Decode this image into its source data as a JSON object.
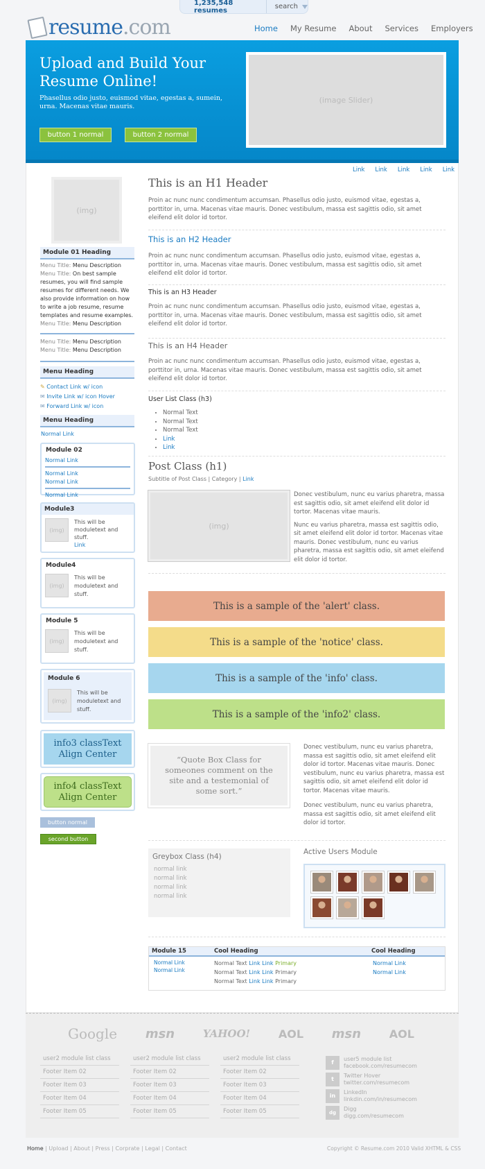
{
  "topbar": {
    "count": "1,235,548 resumes",
    "search": "search"
  },
  "logo": {
    "part1": "resume",
    "part2": ".com"
  },
  "nav": [
    "Home",
    "My Resume",
    "About",
    "Services",
    "Employers"
  ],
  "hero": {
    "title": "Upload and Build Your Resume Online!",
    "text": "Phasellus odio justo, euismod vitae, egestas a, sumein, urna. Macenas vitae mauris.",
    "button1": "button 1 normal",
    "button2": "button 2 normal",
    "slider": "(image Slider)"
  },
  "links": [
    "Link",
    "Link",
    "Link",
    "Link",
    "Link"
  ],
  "sidebar": {
    "img": "(img)",
    "mod01": "Module 01 Heading",
    "menu": [
      {
        "t": "Menu Title:",
        "d": "Menu Description"
      },
      {
        "t": "Menu Title:",
        "d": "On best sample resumes, you will find sample resumes for different needs. We also provide information on how to write a job resume, resume templates and resume examples."
      },
      {
        "t": "Menu Title:",
        "d": "Menu Description"
      }
    ],
    "menu2": [
      {
        "t": "Menu Title:",
        "d": "Menu Description"
      },
      {
        "t": "Menu Title:",
        "d": "Menu Description"
      }
    ],
    "menuHeading": "Menu Heading",
    "iconLinks": [
      "Contact Link w/ icon",
      "Invite Link w/ icon Hover",
      "Forward Link w/ icon"
    ],
    "menuHeading2": "Menu Heading",
    "normalLink": "Normal Link",
    "mod02": "Module 02",
    "mod02links": [
      "Normal Link",
      "Normal Link",
      "Normal Link",
      "Normal Link"
    ],
    "mod3": "Module3",
    "mod4": "Module4",
    "mod5": "Module 5",
    "mod6": "Module 6",
    "modtext": "This will be moduletext and stuff.",
    "modlink": "Link",
    "info3": "info3 classText Align Center",
    "info4": "info4 classText Align Center",
    "btnNormal": "button normal",
    "btnSecond": "second button"
  },
  "content": {
    "h1": "This is an H1 Header",
    "h2": "This is an H2 Header",
    "h3": "This is an H3 Header",
    "h4": "This is an H4 Header",
    "lorem": "Proin ac nunc nunc condimentum accumsan. Phasellus odio justo, euismod vitae, egestas a, porttitor in, urna. Macenas vitae mauris. Donec vestibulum, massa est sagittis odio, sit amet eleifend elit dolor id tortor.",
    "ulTitle": "User List Class (h3)",
    "ul": [
      "Normal Text",
      "Normal Text",
      "Normal Text",
      "Link",
      "Link"
    ],
    "postTitle": "Post Class (h1)",
    "postSub": "Subtitle of Post Class",
    "postCat": "Category",
    "postLink": "Link",
    "postImg": "(img)",
    "postP1": "Donec vestibulum, nunc eu varius pharetra, massa est sagittis odio, sit amet eleifend elit dolor id tortor. Macenas vitae mauris.",
    "postP2": "Nunc eu varius pharetra, massa est sagittis odio, sit amet eleifend elit dolor id tortor. Macenas vitae mauris. Donec vestibulum, nunc eu varius pharetra, massa est sagittis odio, sit amet eleifend elit dolor id tortor.",
    "alert": "This is a sample of the 'alert' class.",
    "notice": "This is a sample of the 'notice' class.",
    "info": "This is a sample of the 'info' class.",
    "info2": "This is a sample of the 'info2' class.",
    "quote": "“Quote Box Class for someones comment on the site and a testemonial of some sort.”",
    "quoteP1": "Donec vestibulum, nunc eu varius pharetra, massa est sagittis odio, sit amet eleifend elit dolor id tortor. Macenas vitae mauris. Donec vestibulum, nunc eu varius pharetra, massa est sagittis odio, sit amet eleifend elit dolor id tortor. Macenas vitae mauris.",
    "quoteP2": "Donec vestibulum, nunc eu varius pharetra, massa est sagittis odio, sit amet eleifend elit dolor id tortor.",
    "greyTitle": "Greybox Class (h4)",
    "greyLinks": [
      "normal link",
      "normal link",
      "normal link",
      "normal link"
    ],
    "activeUsers": "Active Users Module",
    "mod15": "Module 15",
    "cool1": "Cool Heading",
    "cool2": "Cool Heading",
    "mod15links": [
      "Normal Link",
      "Normal Link"
    ],
    "rowText": "Normal Text",
    "rowLink": "Link",
    "primary": "Primary",
    "colLinks": [
      "Normal Link",
      "Normal Link"
    ]
  },
  "footer": {
    "logos": [
      "Google",
      "msn",
      "YAHOO!",
      "AOL",
      "msn",
      "AOL"
    ],
    "colTitle": "user2 module list class",
    "items": [
      "Footer Item 02",
      "Footer Item 03",
      "Footer Item 04",
      "Footer Item 05"
    ],
    "social": [
      {
        "t": "user5 module list",
        "s": "facebook.com/resumecom"
      },
      {
        "t": "Twitter Hover",
        "s": "twitter.com/resumecom"
      },
      {
        "t": "LinkedIn",
        "s": "linkdin.com/in/resumecom"
      },
      {
        "t": "Digg",
        "s": "digg.com/resumecom"
      }
    ],
    "bottom": [
      "Home",
      "Upload",
      "About",
      "Press",
      "Corprate",
      "Legal",
      "Contact"
    ],
    "copyright": "Copyright © Resume.com 2010 Valid XHTML & CSS"
  },
  "colors": {
    "accent": "#1a7bc2",
    "hero": "#0a9ee0",
    "green": "#8bc23e",
    "alert": "#e8ab8f",
    "notice": "#f4dc8a",
    "info": "#a6d6ee",
    "info2": "#bde089"
  }
}
